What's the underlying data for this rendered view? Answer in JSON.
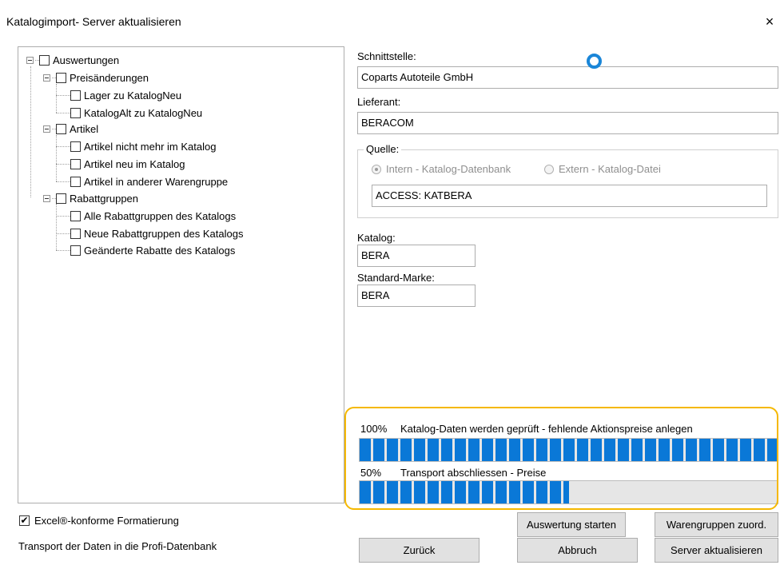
{
  "window": {
    "title": "Katalogimport- Server aktualisieren",
    "close_glyph": "×"
  },
  "tree": {
    "items": [
      {
        "label": "Auswertungen",
        "checked": false
      },
      {
        "label": "Preisänderungen",
        "checked": false
      },
      {
        "label": "Lager zu KatalogNeu",
        "checked": false
      },
      {
        "label": "KatalogAlt zu KatalogNeu",
        "checked": false
      },
      {
        "label": "Artikel",
        "checked": false
      },
      {
        "label": "Artikel nicht mehr im Katalog",
        "checked": false
      },
      {
        "label": "Artikel neu im Katalog",
        "checked": false
      },
      {
        "label": "Artikel in anderer Warengruppe",
        "checked": false
      },
      {
        "label": "Rabattgruppen",
        "checked": false
      },
      {
        "label": "Alle Rabattgruppen des Katalogs",
        "checked": false
      },
      {
        "label": "Neue Rabattgruppen des Katalogs",
        "checked": false
      },
      {
        "label": "Geänderte Rabatte des Katalogs",
        "checked": false
      }
    ]
  },
  "form": {
    "schnittstelle_label": "Schnittstelle:",
    "schnittstelle_value": "Coparts Autoteile GmbH",
    "lieferant_label": "Lieferant:",
    "lieferant_value": "BERACOM",
    "quelle_label": "Quelle:",
    "radio_intern": "Intern - Katalog-Datenbank",
    "radio_extern": "Extern - Katalog-Datei",
    "quelle_selected": "Intern - Katalog-Datenbank",
    "quelle_value": "ACCESS: KATBERA",
    "katalog_label": "Katalog:",
    "katalog_value": "BERA",
    "marke_label": "Standard-Marke:",
    "marke_value": "BERA"
  },
  "progress": [
    {
      "percent": "100%",
      "label": "Katalog-Daten werden geprüft - fehlende Aktionspreise anlegen",
      "value": 1.0
    },
    {
      "percent": "50%",
      "label": "Transport abschliessen - Preise",
      "value": 0.5
    }
  ],
  "options": {
    "excel_label": "Excel®-konforme Formatierung",
    "excel_checked": true
  },
  "status": {
    "info": "Transport der Daten in die Profi-Datenbank"
  },
  "buttons": {
    "auswertung": "Auswertung starten",
    "warengruppen": "Warengruppen zuord.",
    "zurueck": "Zurück",
    "abbruch": "Abbruch",
    "server": "Server aktualisieren"
  },
  "colors": {
    "progress": "#0a78d7",
    "highlight": "#f5b800",
    "busy": "#1a86d8"
  }
}
